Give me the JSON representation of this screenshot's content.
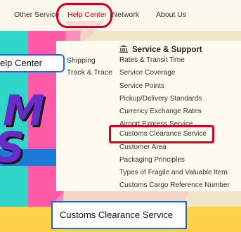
{
  "nav": {
    "items": [
      {
        "label": "Other Service",
        "active": false
      },
      {
        "label": "Help Center",
        "active": true
      },
      {
        "label": "SF Network",
        "active": false
      },
      {
        "label": "About Us",
        "active": false
      }
    ]
  },
  "menu": {
    "left_items": [
      "Shipping",
      "Track & Trace"
    ],
    "section_title": "Service & Support",
    "section_icon": "bank-icon",
    "links": [
      "Rates & Transit Time",
      "Service Coverage",
      "Service Points",
      "Pickup/Delivery Standards",
      "Currency Exchange Rates",
      "Airport Express Service",
      "Customs Clearance Service",
      "Customer Area",
      "Packaging Principles",
      "Types of Fragile and Valuable Item",
      "Customs Cargo Reference Number"
    ]
  },
  "callouts": {
    "help": "elp Center",
    "customs": "Customs Clearance Service"
  },
  "colors": {
    "highlight": "#d0021b",
    "callout_border": "#1f66d6"
  }
}
